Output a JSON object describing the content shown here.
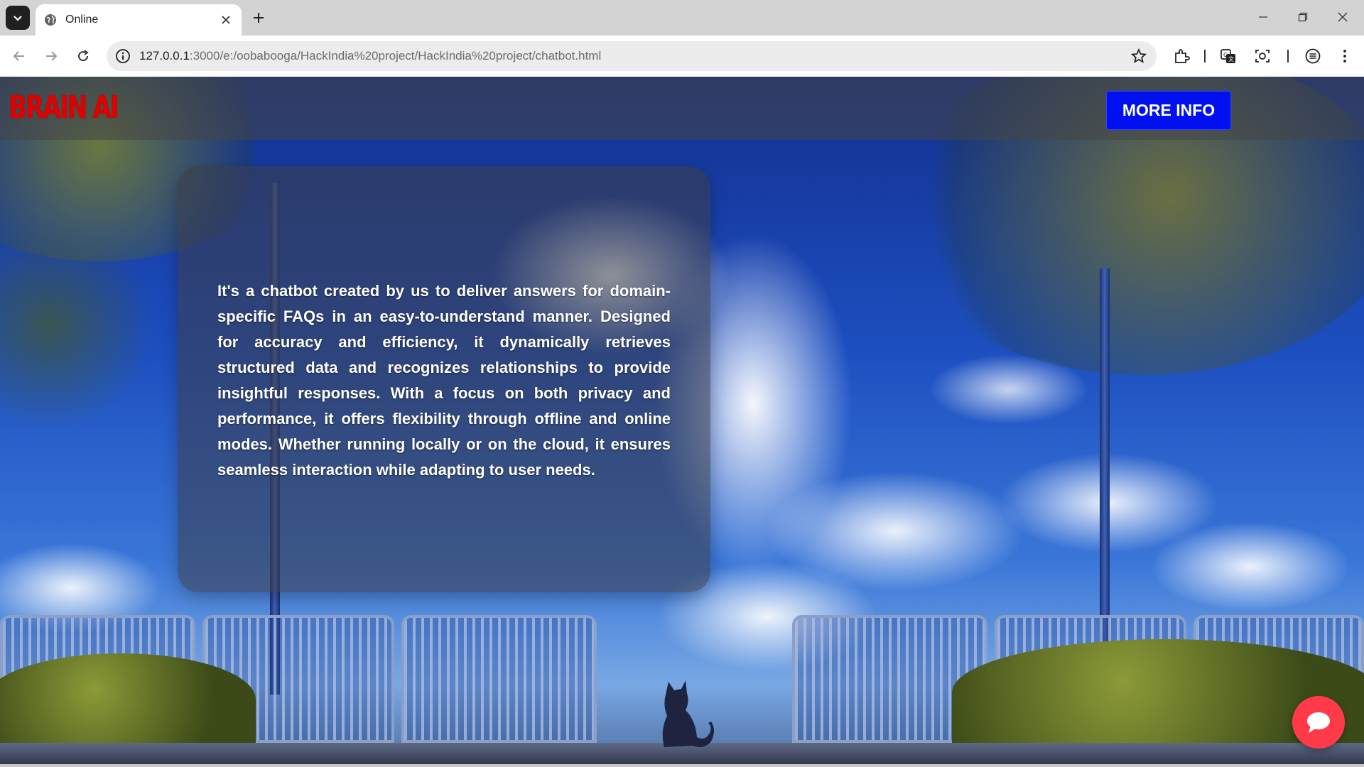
{
  "browser": {
    "tab_title": "Online",
    "url_host": "127.0.0.1",
    "url_rest": ":3000/e:/oobabooga/HackIndia%20project/HackIndia%20project/chatbot.html",
    "icons": [
      "tab-search-icon",
      "globe-icon",
      "close-icon",
      "plus-icon",
      "minimize-icon",
      "restore-icon",
      "window-close-icon",
      "back-icon",
      "forward-icon",
      "reload-icon",
      "site-info-icon",
      "star-icon",
      "extensions-icon",
      "translate-icon",
      "screenshot-icon",
      "menu-list-icon",
      "kebab-menu-icon"
    ]
  },
  "site": {
    "logo": "BRAIN AI",
    "more_info_label": "MORE INFO",
    "description": "It's a chatbot created by us to deliver answers for domain-specific FAQs in an easy-to-understand manner. Designed for accuracy and efficiency, it dynamically retrieves structured data and recognizes relationships to provide insightful responses. With a focus on both privacy and performance, it offers flexibility through offline and online modes. Whether running locally or on the cloud, it ensures seamless interaction while adapting to user needs.",
    "chat_icon": "chat-bubble-icon"
  },
  "colors": {
    "logo_red": "#e00000",
    "button_blue": "#0010f0",
    "chat_red": "#ff3b4a"
  }
}
